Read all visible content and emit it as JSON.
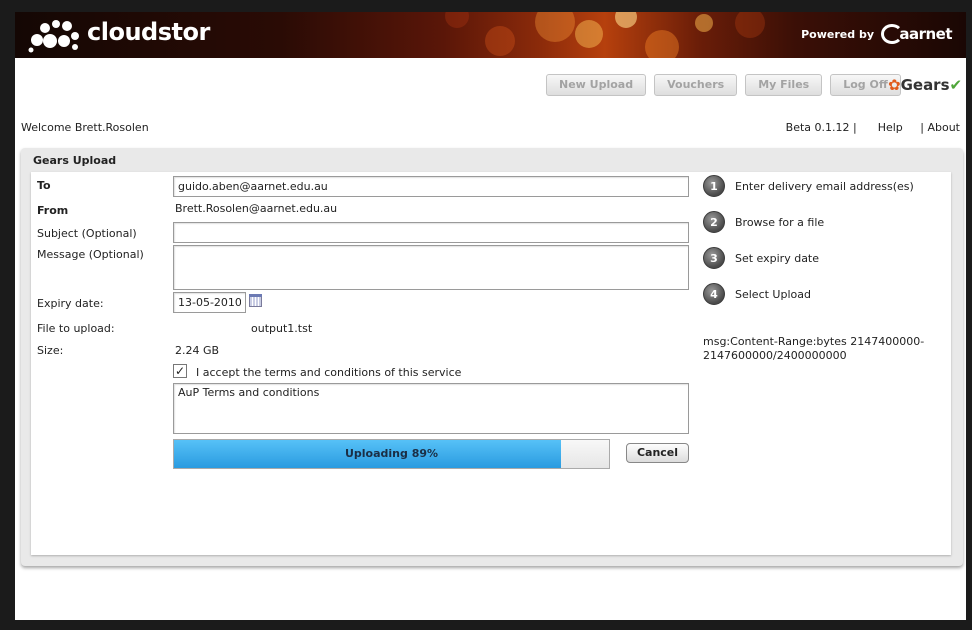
{
  "header": {
    "logo_text": "cloudstor",
    "powered_by": "Powered by",
    "partner_logo": "aarnet"
  },
  "nav": {
    "buttons": [
      "New Upload",
      "Vouchers",
      "My Files",
      "Log Off"
    ],
    "gears_logo": "Gears"
  },
  "user_bar": {
    "welcome": "Welcome Brett.Rosolen",
    "version": "Beta 0.1.12 |",
    "help": "Help",
    "about": "| About"
  },
  "panel": {
    "title": "Gears Upload"
  },
  "form": {
    "to_label": "To",
    "to_value": "guido.aben@aarnet.edu.au",
    "from_label": "From",
    "from_value": "Brett.Rosolen@aarnet.edu.au",
    "subject_label": "Subject (Optional)",
    "subject_value": "",
    "message_label": "Message (Optional)",
    "message_value": "",
    "expiry_label": "Expiry date:",
    "expiry_value": "13-05-2010",
    "file_label": "File to upload:",
    "file_value": "output1.tst",
    "size_label": "Size:",
    "size_value": "2.24 GB",
    "terms_checked": true,
    "terms_label": "I accept the terms and conditions of this service",
    "terms_text": "AuP Terms and conditions",
    "progress_label": "Uploading 89%",
    "progress_fraction": 0.89,
    "cancel_label": "Cancel"
  },
  "steps": [
    {
      "num": "1",
      "text": "Enter delivery email address(es)"
    },
    {
      "num": "2",
      "text": "Browse for a file"
    },
    {
      "num": "3",
      "text": "Set expiry date"
    },
    {
      "num": "4",
      "text": "Select Upload"
    }
  ],
  "status_msg": "msg:Content-Range:bytes 2147400000-2147600000/2400000000",
  "icons": [
    "cloudstor-logo-icon",
    "aarnet-logo-icon",
    "gears-logo-icon",
    "calendar-icon",
    "checkbox-check-icon"
  ]
}
